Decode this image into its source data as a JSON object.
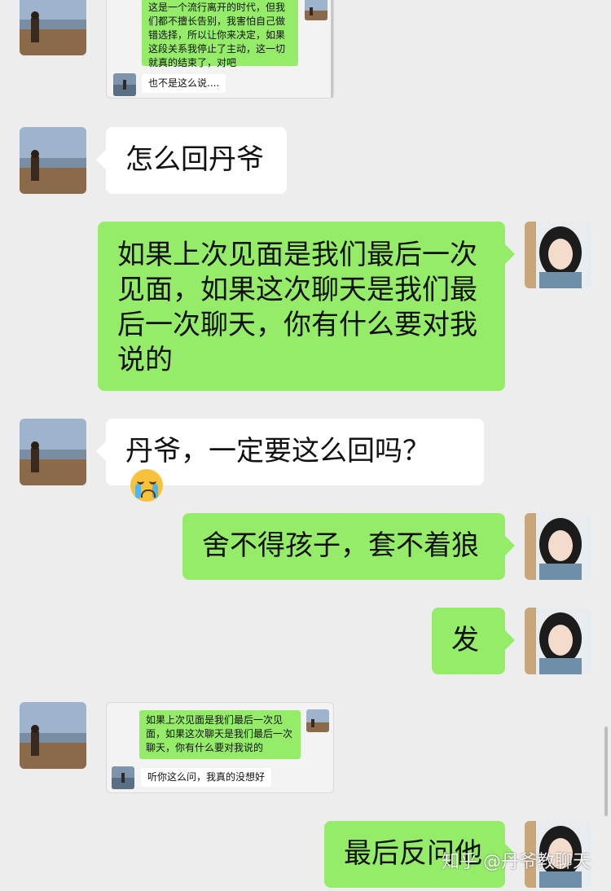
{
  "messages": {
    "m1": {
      "quoted_green": "这是一个流行离开的时代，但我们都不擅长告别，我害怕自己做错选择，所以让你来决定，如果这段关系我停止了主动，这一切就真的结束了，对吧",
      "quoted_white": "也不是这么说...."
    },
    "m2": {
      "text": "怎么回丹爷"
    },
    "m3": {
      "text": "如果上次见面是我们最后一次见面，如果这次聊天是我们最后一次聊天，你有什么要对我说的"
    },
    "m4": {
      "text": "丹爷，一定要这么回吗？",
      "emoji": "crying-face"
    },
    "m5": {
      "text": "舍不得孩子，套不着狼"
    },
    "m6": {
      "text": "发"
    },
    "m7": {
      "quoted_green": "如果上次见面是我们最后一次见面，如果这次聊天是我们最后一次聊天，你有什么要对我说的",
      "quoted_white": "听你这么问，我真的没想好"
    },
    "m8": {
      "text": "最后反问他"
    }
  },
  "watermark": "知乎 @丹爷教聊天",
  "colors": {
    "background": "#ededed",
    "green_bubble": "#95ec69",
    "white_bubble": "#ffffff"
  }
}
